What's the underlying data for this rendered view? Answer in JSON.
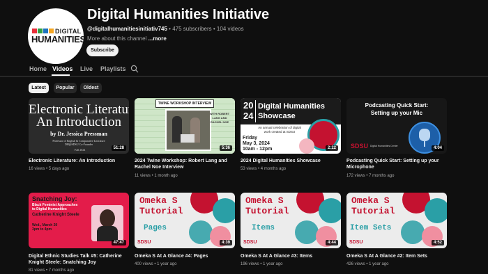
{
  "channel": {
    "logo_top": "DIGITAL",
    "logo_main": "HUMANITIES",
    "name": "Digital Humanities Initiative",
    "handle": "@digitalhumanitiesinitiativ745",
    "sep1": " • ",
    "subscribers": "475 subscribers",
    "sep2": " • ",
    "video_count": "104 videos",
    "about": "More about this channel ",
    "more": "...more",
    "subscribe_label": "Subscribe"
  },
  "tabs": [
    {
      "label": "Home"
    },
    {
      "label": "Videos"
    },
    {
      "label": "Live"
    },
    {
      "label": "Playlists"
    }
  ],
  "chips": [
    {
      "label": "Latest"
    },
    {
      "label": "Popular"
    },
    {
      "label": "Oldest"
    }
  ],
  "videos": [
    {
      "title": "Electronic Literature: An Introduction",
      "views": "16 views",
      "age": "5 days ago",
      "duration": "51:28"
    },
    {
      "title": "2024 Twine Workshop: Robert Lang and Rachel Noe Interview",
      "views": "11 views",
      "age": "1 month ago",
      "duration": "5:36"
    },
    {
      "title": "2024 Digital Humanities Showcase",
      "views": "53 views",
      "age": "4 months ago",
      "duration": "2:22"
    },
    {
      "title": "Podcasting Quick Start: Setting up your Microphone",
      "views": "172 views",
      "age": "7 months ago",
      "duration": "4:04"
    },
    {
      "title": "Digital Ethnic Studies Talk #5: Catherine Knight Steele: Snatching Joy",
      "views": "81 views",
      "age": "7 months ago",
      "duration": "47:47"
    },
    {
      "title": "Omeka S At A Glance #4: Pages",
      "views": "400 views",
      "age": "1 year ago",
      "duration": "4:39"
    },
    {
      "title": "Omeka S At A Glance #3: Items",
      "views": "196 views",
      "age": "1 year ago",
      "duration": "4:44"
    },
    {
      "title": "Omeka S At A Glance #2: Item Sets",
      "views": "426 views",
      "age": "1 year ago",
      "duration": "4:52"
    }
  ],
  "thumbs": {
    "elit": {
      "l1": "Electronic Literature:",
      "l2": "An Introduction",
      "l3": "by Dr. Jessica Pressman",
      "l4": "Professor of English & Comparative Literature",
      "l5": "DH@SDSU Co-Founder",
      "l6": "Fall 2024"
    },
    "twine": {
      "banner": "TWINE WORKSHOP INTERVIEW",
      "caption": "WITH ROBERT LANG AND RACHEL NOE"
    },
    "showcase": {
      "y1": "20",
      "y2": "24",
      "t1": "Digital Humanities",
      "t2": "Showcase",
      "sub": "An annual celebration of digital work created at SDSU",
      "date1": "Friday",
      "date2": "May 3, 2024",
      "time": "10am - 12pm"
    },
    "podcast": {
      "t1": "Podcasting Quick Start:",
      "t2": "Setting up your Mic",
      "logo": "SDSU",
      "dept": "Digital Humanities Center"
    },
    "snatch": {
      "t1": "Snatching Joy:",
      "t2": "Black Feminist Approaches",
      "t3": "to Digital Humanities",
      "name": "Catherine Knight Steele",
      "when1": "Wed., March 20",
      "when2": "3pm to 4pm"
    },
    "omeka_pages": {
      "t1": "Omeka S",
      "t2": "Tutorial",
      "sub": "Pages",
      "logo": "SDSU"
    },
    "omeka_items": {
      "t1": "Omeka S",
      "t2": "Tutorial",
      "sub": "Items",
      "logo": "SDSU"
    },
    "omeka_sets": {
      "t1": "Omeka S",
      "t2": "Tutorial",
      "sub": "Item Sets",
      "logo": "SDSU"
    }
  },
  "colors": {
    "background": "#0f0f0f",
    "primary_text": "#f1f1f1",
    "secondary_text": "#aaaaaa",
    "chip_active": "#f1f1f1",
    "chip_inactive": "#272727",
    "sdsu_red": "#c41230",
    "logo_squares": [
      "#e8303a",
      "#2f9e44",
      "#1e73be",
      "#f5a623"
    ]
  }
}
